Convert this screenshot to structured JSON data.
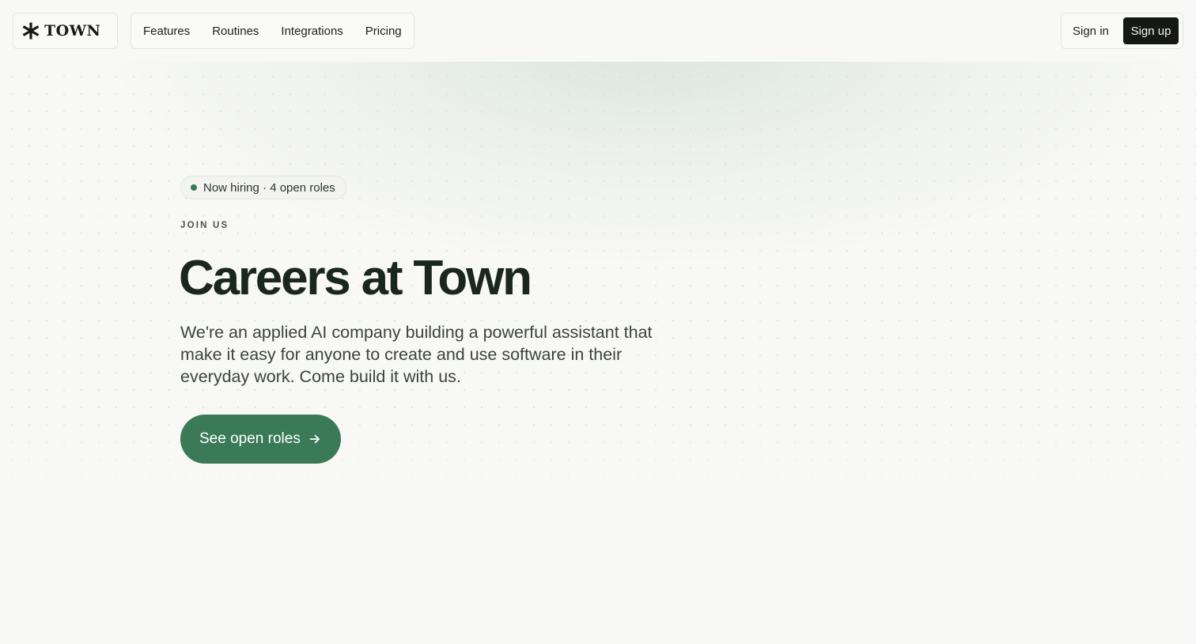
{
  "brand": {
    "name": "TOWN",
    "icon": "asterisk-logo-icon"
  },
  "nav": {
    "items": [
      {
        "label": "Features"
      },
      {
        "label": "Routines"
      },
      {
        "label": "Integrations"
      },
      {
        "label": "Pricing"
      }
    ]
  },
  "auth": {
    "sign_in": "Sign in",
    "sign_up": "Sign up"
  },
  "hero": {
    "badge": "Now hiring · 4 open roles",
    "eyebrow": "JOIN US",
    "title": "Careers at Town",
    "description": "We're an applied AI company building a powerful assistant that make it easy for anyone to create and use software in their everyday work. Come build it with us.",
    "cta_label": "See open roles",
    "cta_icon": "arrow-right-icon"
  },
  "colors": {
    "accent": "#3b7a57",
    "dark": "#161816",
    "background": "#f8f8f6",
    "heading": "#1b2620"
  }
}
